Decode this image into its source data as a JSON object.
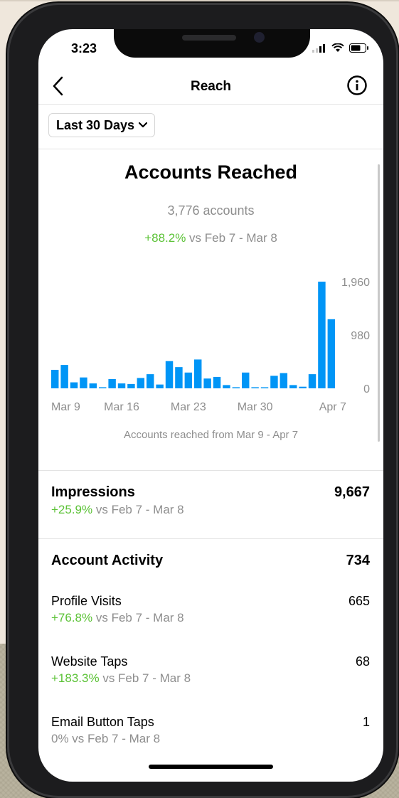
{
  "status_bar": {
    "time": "3:23"
  },
  "nav": {
    "title": "Reach",
    "back_icon": "chevron-left-icon",
    "info_icon": "info-icon"
  },
  "filter": {
    "label": "Last 30 Days",
    "icon": "chevron-down-icon"
  },
  "reach": {
    "title": "Accounts Reached",
    "accounts": "3,776 accounts",
    "change": "+88.2%",
    "change_suffix": " vs Feb 7 - Mar 8",
    "caption": "Accounts reached from Mar 9 - Apr 7"
  },
  "chart_data": {
    "type": "bar",
    "x_ticks": [
      "Mar 9",
      "Mar 16",
      "Mar 23",
      "Mar 30",
      "Apr 7"
    ],
    "y_ticks": [
      "1,960",
      "980",
      "0"
    ],
    "ylim": [
      0,
      1960
    ],
    "color": "#0095f6",
    "values": [
      340,
      430,
      110,
      200,
      90,
      20,
      170,
      90,
      80,
      190,
      260,
      70,
      500,
      390,
      290,
      530,
      180,
      210,
      60,
      20,
      290,
      20,
      10,
      230,
      280,
      60,
      30,
      260,
      1960,
      1270
    ]
  },
  "impressions": {
    "label": "Impressions",
    "value": "9,667",
    "change": "+25.9%",
    "change_suffix": " vs Feb 7 - Mar 8"
  },
  "activity": {
    "title": "Account Activity",
    "value": "734",
    "items": [
      {
        "label": "Profile Visits",
        "value": "665",
        "change": "+76.8%",
        "change_suffix": " vs Feb 7 - Mar 8"
      },
      {
        "label": "Website Taps",
        "value": "68",
        "change": "+183.3%",
        "change_suffix": " vs Feb 7 - Mar 8"
      },
      {
        "label": "Email Button Taps",
        "value": "1",
        "change": "0%",
        "change_suffix": " vs Feb 7 - Mar 8"
      }
    ]
  }
}
